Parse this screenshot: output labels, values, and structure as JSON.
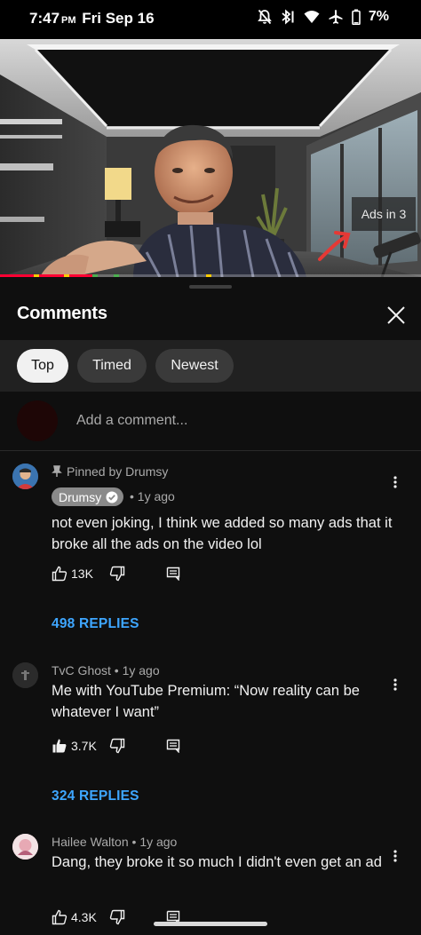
{
  "status_bar": {
    "time": "7:47",
    "ampm": "PM",
    "date": "Fri Sep 16",
    "battery": "7%",
    "icons": [
      "bell-off-icon",
      "bluetooth-icon",
      "wifi-icon",
      "airplane-icon",
      "battery-icon"
    ]
  },
  "video": {
    "ads_countdown": "Ads in 3",
    "progress": 0.22
  },
  "comments_panel": {
    "title": "Comments",
    "filters": [
      "Top",
      "Timed",
      "Newest"
    ],
    "selected_filter": "Top",
    "add_comment_placeholder": "Add a comment..."
  },
  "comments": [
    {
      "pinned_label": "Pinned by Drumsy",
      "author": "Drumsy",
      "verified": true,
      "age": "• 1y ago",
      "text": "not even joking, I think we added so many ads that it broke all the ads on the video lol",
      "likes": "13K",
      "liked": false,
      "replies": "498 REPLIES"
    },
    {
      "author_line": "TvC Ghost • 1y ago",
      "text": "Me with YouTube Premium: “Now reality can be whatever I want”",
      "likes": "3.7K",
      "liked": true,
      "replies": "324 REPLIES"
    },
    {
      "author_line": "Hailee Walton • 1y ago",
      "text": "Dang, they broke it so much I didn't even get an ad",
      "likes": "4.3K",
      "liked": false
    }
  ],
  "colors": {
    "accent_link": "#3ea6ff",
    "progress": "#ff0033",
    "panel_bg": "#0f0f0f"
  }
}
